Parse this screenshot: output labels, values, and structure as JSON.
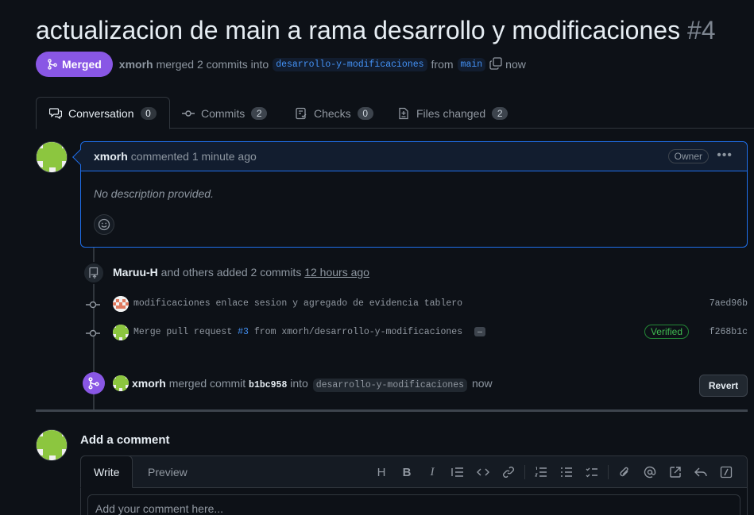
{
  "pr": {
    "title": "actualizacion de main a rama desarrollo y modificaciones",
    "number": "#4",
    "state": "Merged",
    "author": "xmorh",
    "merge_text": "merged 2 commits into",
    "base_branch": "desarrollo-y-modificaciones",
    "from_text": "from",
    "head_branch": "main",
    "time": "now"
  },
  "tabs": [
    {
      "label": "Conversation",
      "count": "0",
      "icon": "conversation-icon"
    },
    {
      "label": "Commits",
      "count": "2",
      "icon": "commit-icon"
    },
    {
      "label": "Checks",
      "count": "0",
      "icon": "checklist-icon"
    },
    {
      "label": "Files changed",
      "count": "2",
      "icon": "file-diff-icon"
    }
  ],
  "comment": {
    "author": "xmorh",
    "action": "commented",
    "time": "1 minute ago",
    "role": "Owner",
    "body": "No description provided."
  },
  "commits_event": {
    "author": "Maruu-H",
    "text": "and others added 2 commits",
    "time": "12 hours ago"
  },
  "commits": [
    {
      "message": "modificaciones enlace sesion y agregado de evidencia tablero",
      "sha": "7aed96b",
      "verified": ""
    },
    {
      "message_prefix": "Merge pull request",
      "pr_link": "#3",
      "message_suffix": "from xmorh/desarrollo-y-modificaciones",
      "more": "…",
      "sha": "f268b1c",
      "verified": "Verified"
    }
  ],
  "merge_event": {
    "author": "xmorh",
    "text": "merged commit",
    "sha": "b1bc958",
    "into": "into",
    "branch": "desarrollo-y-modificaciones",
    "time": "now",
    "revert_label": "Revert"
  },
  "add_comment": {
    "title": "Add a comment",
    "tab_write": "Write",
    "tab_preview": "Preview",
    "placeholder": "Add your comment here...",
    "toolbar": [
      "H",
      "B",
      "I"
    ]
  },
  "colors": {
    "merged": "#8957e5",
    "link": "#4493f8",
    "verified": "#3fb950",
    "focus_border": "#1f6feb"
  }
}
